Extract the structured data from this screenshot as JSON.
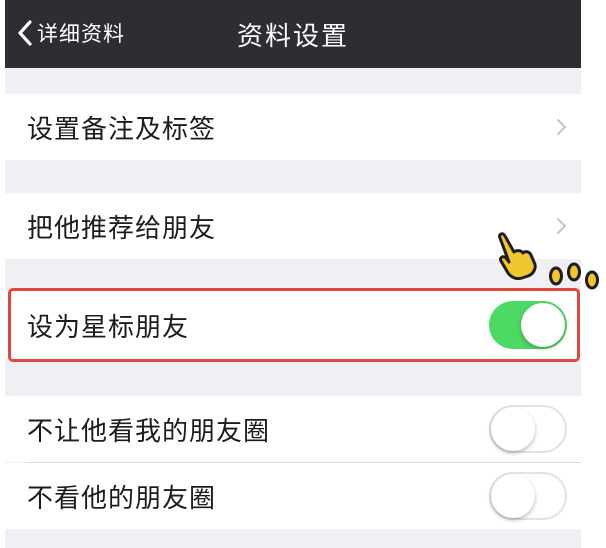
{
  "navbar": {
    "back_label": "详细资料",
    "title": "资料设置"
  },
  "rows": [
    {
      "label": "设置备注及标签",
      "control": "chevron"
    },
    {
      "label": "把他推荐给朋友",
      "control": "chevron"
    },
    {
      "label": "设为星标朋友",
      "control": "toggle",
      "on": true
    },
    {
      "label": "不让他看我的朋友圈",
      "control": "toggle",
      "on": false
    },
    {
      "label": "不看他的朋友圈",
      "control": "toggle",
      "on": false
    }
  ],
  "colors": {
    "navbar": "#2e2d32",
    "toggle_on": "#4cd964",
    "highlight": "#e2463c",
    "annotation": "#f2c62f"
  },
  "icons": {
    "back": "chevron-left-icon",
    "disclosure": "chevron-right-icon",
    "annotation": "pointing-hand-icon"
  }
}
